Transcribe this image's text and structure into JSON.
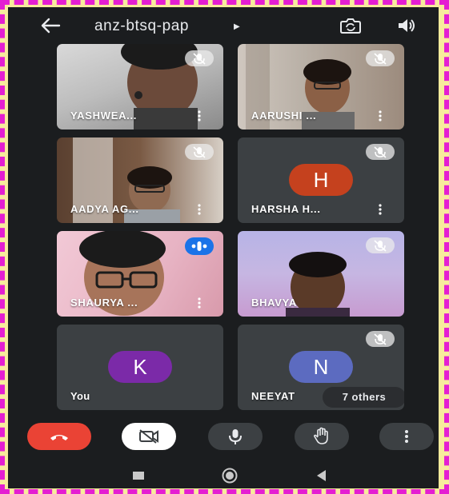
{
  "meeting": {
    "title": "anz-btsq-pap"
  },
  "participants": [
    {
      "name": "YASHWEA...",
      "muted": true
    },
    {
      "name": "AARUSHI ...",
      "muted": true
    },
    {
      "name": "AADYA AG...",
      "muted": true
    },
    {
      "name": "HARSHA H...",
      "muted": true,
      "initial": "H",
      "avatar_color": "#c5411e"
    },
    {
      "name": "SHAURYA ...",
      "muted": false,
      "speaking": true
    },
    {
      "name": "BHAVYA",
      "muted": true
    },
    {
      "name": "You",
      "initial": "K",
      "avatar_color": "#7b2aa8"
    },
    {
      "name": "NEEYAT",
      "muted": true,
      "initial": "N",
      "avatar_color": "#5c6bc0"
    }
  ],
  "others_label": "7 others",
  "controls": {
    "end_call_color": "#ea4335",
    "camera_off_color": "#ffffff",
    "buttons": [
      "end-call",
      "camera-off",
      "microphone",
      "raise-hand",
      "more-options"
    ]
  },
  "colors": {
    "screen_bg": "#1b1d1f",
    "tile_bg": "#3c4043",
    "speaking": "#1a73e8",
    "frame_dash": "#e41ed2",
    "page_bg": "#f7eb9c"
  }
}
